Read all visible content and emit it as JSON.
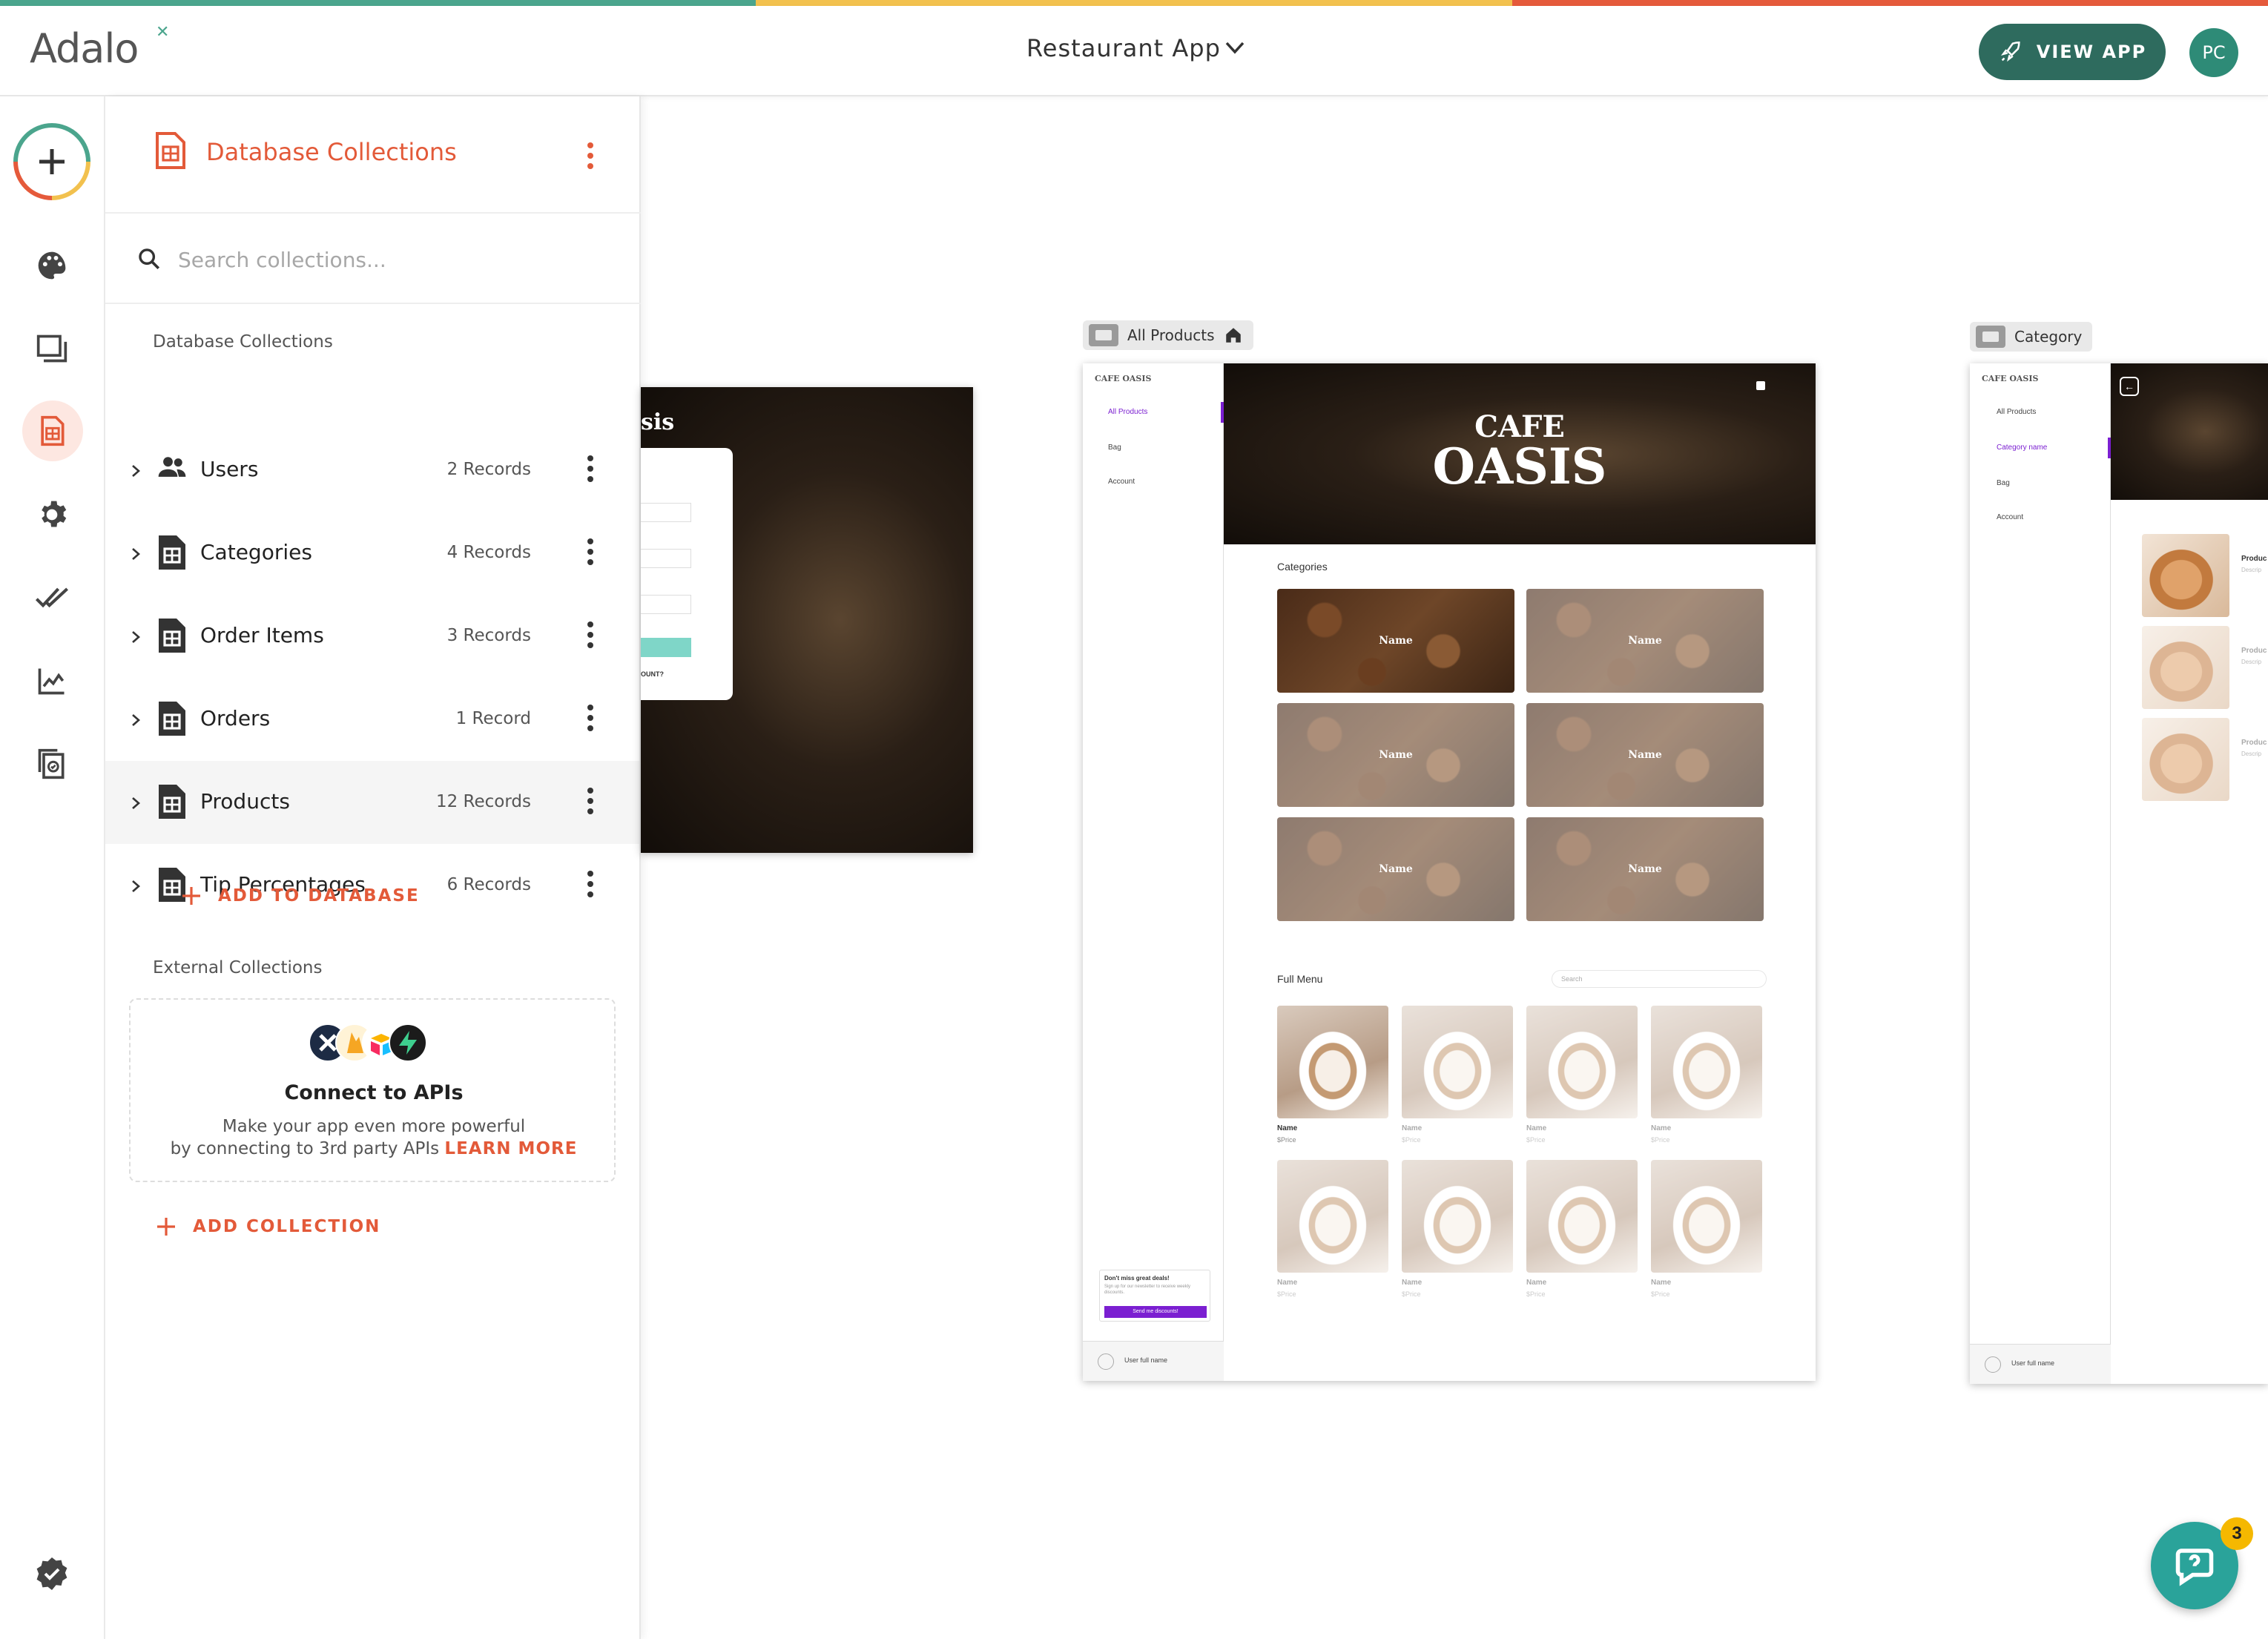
{
  "brand": {
    "logo_text": "Adalo",
    "stripe_colors": [
      "#4ba58d",
      "#f2c14e",
      "#e55a3b"
    ]
  },
  "header": {
    "app_name": "Restaurant App",
    "view_app_label": "VIEW APP",
    "avatar_initials": "PC",
    "accent_color": "#2e6b5e"
  },
  "rail": {
    "items": [
      "add-icon",
      "palette-icon",
      "screens-icon",
      "database-icon",
      "settings-icon",
      "publish-check-icon",
      "analytics-icon",
      "versions-icon",
      "verified-icon"
    ],
    "active": "database-icon"
  },
  "panel": {
    "title": "Database Collections",
    "search_placeholder": "Search collections...",
    "db_section_label": "Database Collections",
    "collections": [
      {
        "name": "Users",
        "count": "2 Records",
        "icon": "users-icon"
      },
      {
        "name": "Categories",
        "count": "4 Records",
        "icon": "table-icon"
      },
      {
        "name": "Order Items",
        "count": "3 Records",
        "icon": "table-icon"
      },
      {
        "name": "Orders",
        "count": "1 Record",
        "icon": "table-icon"
      },
      {
        "name": "Products",
        "count": "12 Records",
        "icon": "table-icon",
        "active": true
      },
      {
        "name": "Tip Percentages",
        "count": "6 Records",
        "icon": "table-icon"
      }
    ],
    "add_to_database_label": "ADD TO DATABASE",
    "external_section_label": "External Collections",
    "external_card": {
      "title": "Connect to APIs",
      "desc_line1": "Make your app even more powerful",
      "desc_line2": "by connecting to 3rd party APIs",
      "learn_more": "LEARN MORE"
    },
    "add_collection_label": "ADD COLLECTION",
    "accent_color": "#e35a39"
  },
  "canvas": {
    "login_screen": {
      "partial_title": "sis",
      "partial_link": "OUNT?"
    },
    "all_products_screen": {
      "tag": "All Products",
      "brand": "CAFE OASIS",
      "nav": [
        "All Products",
        "Bag",
        "Account"
      ],
      "hero_line1": "CAFE",
      "hero_line2": "OASIS",
      "categories_label": "Categories",
      "category_tile_label": "Name",
      "full_menu_label": "Full Menu",
      "search_placeholder": "Search",
      "product_name": "Name",
      "product_price": "$Price",
      "promo_title": "Don't miss great deals!",
      "promo_text": "Sign up for our newsletter to receive weekly discounts.",
      "promo_button": "Send me discounts!",
      "user_label": "User full name",
      "accent_color": "#7b1fd1"
    },
    "category_screen": {
      "tag": "Category",
      "brand": "CAFE OASIS",
      "nav": [
        "All Products",
        "Category name",
        "Bag",
        "Account"
      ],
      "product_label": "Produc",
      "desc_label": "Descrip",
      "user_label": "User full name"
    }
  },
  "help_widget": {
    "badge": "3"
  }
}
